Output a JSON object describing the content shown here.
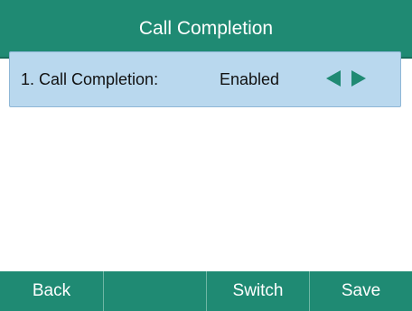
{
  "header": {
    "title": "Call Completion"
  },
  "settings": {
    "items": [
      {
        "label": "1. Call Completion:",
        "value": "Enabled"
      }
    ]
  },
  "softkeys": [
    "Back",
    "",
    "Switch",
    "Save"
  ],
  "colors": {
    "accent": "#1f8a73",
    "selected_row": "#b9d8ee"
  }
}
